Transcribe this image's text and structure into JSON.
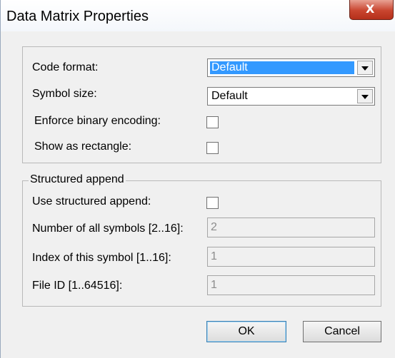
{
  "window": {
    "title": "Data Matrix Properties",
    "close_glyph": "X"
  },
  "format_group": {
    "code_format": {
      "label": "Code format:",
      "value": "Default"
    },
    "symbol_size": {
      "label": "Symbol size:",
      "value": "Default"
    },
    "enforce_binary": {
      "label": "Enforce binary encoding:",
      "checked": false
    },
    "show_rectangle": {
      "label": "Show as rectangle:",
      "checked": false
    }
  },
  "structured_append": {
    "title": "Structured append",
    "use": {
      "label": "Use structured append:",
      "checked": false
    },
    "number_of_symbols": {
      "label": "Number of all symbols [2..16]:",
      "value": "2"
    },
    "index_of_symbol": {
      "label": "Index of this symbol [1..16]:",
      "value": "1"
    },
    "file_id": {
      "label": "File ID [1..64516]:",
      "value": "1"
    }
  },
  "buttons": {
    "ok": "OK",
    "cancel": "Cancel"
  },
  "colors": {
    "selection": "#3399ff",
    "close_button": "#c9452f",
    "dialog_bg": "#f0f0f0"
  }
}
